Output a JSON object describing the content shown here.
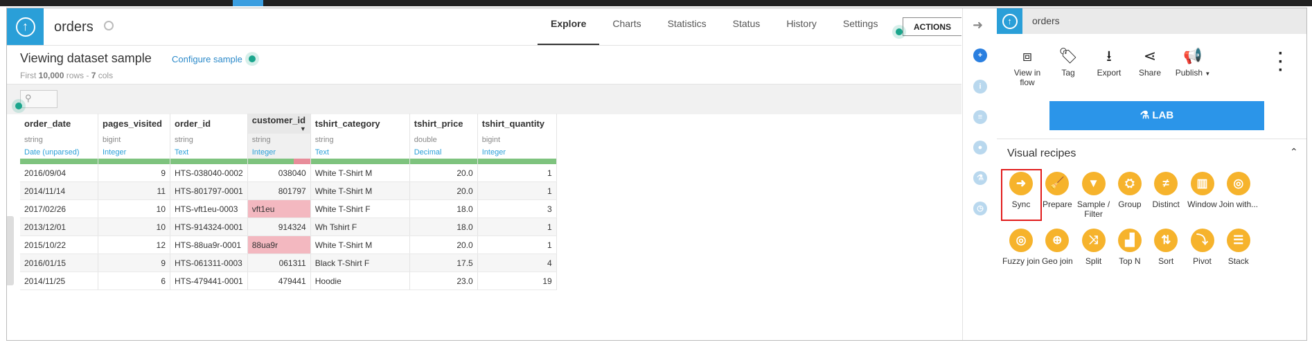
{
  "header": {
    "dataset_name": "orders",
    "tabs": [
      {
        "label": "Explore",
        "active": true
      },
      {
        "label": "Charts",
        "active": false
      },
      {
        "label": "Statistics",
        "active": false
      },
      {
        "label": "Status",
        "active": false
      },
      {
        "label": "History",
        "active": false
      },
      {
        "label": "Settings",
        "active": false
      }
    ],
    "actions_label": "ACTIONS"
  },
  "sample": {
    "title": "Viewing dataset sample",
    "configure_link": "Configure sample",
    "info_first": "First ",
    "info_rows": "10,000",
    "info_rows_word": " rows - ",
    "info_cols": "7",
    "info_cols_word": " cols"
  },
  "search": {
    "icon": "search-icon"
  },
  "table": {
    "columns": [
      {
        "name": "order_date",
        "storage": "string",
        "meaning": "Date (unparsed)"
      },
      {
        "name": "pages_visited",
        "storage": "bigint",
        "meaning": "Integer"
      },
      {
        "name": "order_id",
        "storage": "string",
        "meaning": "Text"
      },
      {
        "name": "customer_id",
        "storage": "string",
        "meaning": "Integer",
        "has_dropdown": true
      },
      {
        "name": "tshirt_category",
        "storage": "string",
        "meaning": "Text"
      },
      {
        "name": "tshirt_price",
        "storage": "double",
        "meaning": "Decimal"
      },
      {
        "name": "tshirt_quantity",
        "storage": "bigint",
        "meaning": "Integer"
      }
    ],
    "rows": [
      [
        "2016/09/04",
        "9",
        "HTS-038040-0002",
        "038040",
        "White T-Shirt M",
        "20.0",
        "1"
      ],
      [
        "2014/11/14",
        "11",
        "HTS-801797-0001",
        "801797",
        "White T-Shirt M",
        "20.0",
        "1"
      ],
      [
        "2017/02/26",
        "10",
        "HTS-vft1eu-0003",
        "vft1eu",
        "White T-Shirt F",
        "18.0",
        "3"
      ],
      [
        "2013/12/01",
        "10",
        "HTS-914324-0001",
        "914324",
        "Wh Tshirt F",
        "18.0",
        "1"
      ],
      [
        "2015/10/22",
        "12",
        "HTS-88ua9r-0001",
        "88ua9r",
        "White T-Shirt M",
        "20.0",
        "1"
      ],
      [
        "2016/01/15",
        "9",
        "HTS-061311-0003",
        "061311",
        "Black T-Shirt F",
        "17.5",
        "4"
      ],
      [
        "2014/11/25",
        "6",
        "HTS-479441-0001",
        "479441",
        "Hoodie",
        "23.0",
        "19"
      ]
    ],
    "invalid_cells": [
      [
        2,
        3
      ],
      [
        4,
        3
      ]
    ]
  },
  "right_panel": {
    "dataset_name": "orders",
    "actions": [
      {
        "label": "View in flow",
        "icon": "flow-icon"
      },
      {
        "label": "Tag",
        "icon": "tag-icon"
      },
      {
        "label": "Export",
        "icon": "export-icon"
      },
      {
        "label": "Share",
        "icon": "share-icon"
      },
      {
        "label": "Publish",
        "icon": "publish-icon"
      }
    ],
    "lab_label": "LAB",
    "visual_recipes_title": "Visual recipes",
    "recipes": [
      {
        "label": "Sync",
        "icon": "arrow-right-icon"
      },
      {
        "label": "Prepare",
        "icon": "broom-icon"
      },
      {
        "label": "Sample / Filter",
        "icon": "filter-icon"
      },
      {
        "label": "Group",
        "icon": "group-icon"
      },
      {
        "label": "Distinct",
        "icon": "not-equal-icon"
      },
      {
        "label": "Window",
        "icon": "window-icon"
      },
      {
        "label": "Join with...",
        "icon": "join-icon"
      },
      {
        "label": "Fuzzy join",
        "icon": "fuzzy-join-icon"
      },
      {
        "label": "Geo join",
        "icon": "globe-icon"
      },
      {
        "label": "Split",
        "icon": "split-icon"
      },
      {
        "label": "Top N",
        "icon": "top-n-icon"
      },
      {
        "label": "Sort",
        "icon": "sort-icon"
      },
      {
        "label": "Pivot",
        "icon": "pivot-icon"
      },
      {
        "label": "Stack",
        "icon": "stack-icon"
      }
    ]
  },
  "colors": {
    "brand_blue": "#2a9fd8",
    "lab_blue": "#2b95e9",
    "recipe_yellow": "#f6b32c",
    "valid_green": "#7ec37e",
    "invalid_pink": "#f3b8c0",
    "highlight_red": "#e11b1b"
  }
}
